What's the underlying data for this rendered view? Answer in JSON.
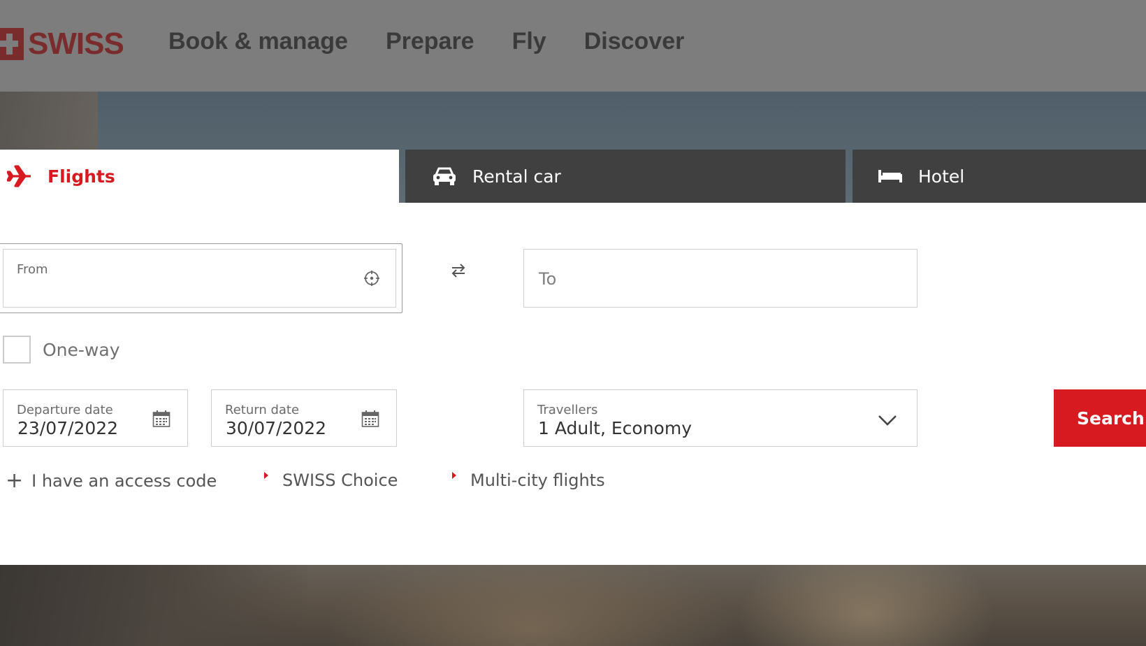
{
  "brand": {
    "logo_text": "SWISS",
    "accent_color": "#d71920"
  },
  "nav": {
    "items": [
      "Book & manage",
      "Prepare",
      "Fly",
      "Discover"
    ]
  },
  "tabs": [
    {
      "label": "Flights",
      "icon": "airplane-icon",
      "active": true
    },
    {
      "label": "Rental car",
      "icon": "car-icon",
      "active": false
    },
    {
      "label": "Hotel",
      "icon": "bed-icon",
      "active": false
    }
  ],
  "form": {
    "from_label": "From",
    "from_value": "",
    "to_placeholder": "To",
    "one_way_label": "One-way",
    "one_way_checked": false,
    "departure_label": "Departure date",
    "departure_value": "23/07/2022",
    "return_label": "Return date",
    "return_value": "30/07/2022",
    "travellers_label": "Travellers",
    "travellers_value": "1 Adult, Economy",
    "search_label": "Search"
  },
  "links": {
    "access_code": "I have an access code",
    "swiss_choice": "SWISS Choice",
    "multi_city": "Multi-city flights"
  }
}
